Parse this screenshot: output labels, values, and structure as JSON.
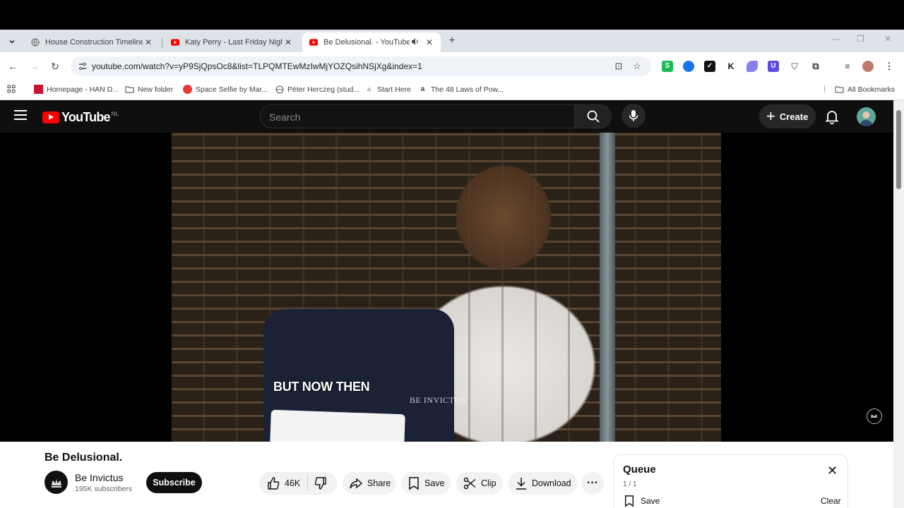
{
  "browser": {
    "tabs": [
      {
        "title": "House Construction Timeline",
        "active": false
      },
      {
        "title": "Katy Perry - Last Friday Night (T",
        "active": false
      },
      {
        "title": "Be Delusional. - YouTube",
        "active": true
      }
    ],
    "url": "youtube.com/watch?v=yP9SjQpsOc8&list=TLPQMTEwMzIwMjYOZQsihNSjXg&index=1",
    "bookmarks": [
      {
        "label": "Homepage - HAN D..."
      },
      {
        "label": "New folder"
      },
      {
        "label": "Space Selfie by Mar..."
      },
      {
        "label": "Péter Herczeg (stud..."
      },
      {
        "label": "Start Here"
      },
      {
        "label": "The 48 Laws of Pow..."
      }
    ],
    "all_bookmarks": "All Bookmarks",
    "extensions": [
      {
        "label": "S",
        "color": "#1db954"
      },
      {
        "label": "",
        "color": "#1a73e8"
      },
      {
        "label": "✓",
        "color": "#111111"
      },
      {
        "label": "K",
        "color": "#ffffff"
      },
      {
        "label": "",
        "color": "#8a7ff0"
      },
      {
        "label": "U",
        "color": "#5b4bdb"
      }
    ]
  },
  "youtube": {
    "logo": "YouTube",
    "country": "NL",
    "search_placeholder": "Search",
    "create_label": "Create",
    "video": {
      "subtitle": "BUT NOW THEN",
      "watermark": "BE INVICTUS",
      "title": "Be Delusional."
    },
    "channel": {
      "name": "Be Invictus",
      "subscribers": "195K subscribers",
      "subscribe_label": "Subscribe"
    },
    "actions": {
      "likes": "46K",
      "share": "Share",
      "save": "Save",
      "clip": "Clip",
      "download": "Download"
    },
    "queue": {
      "title": "Queue",
      "count": "1 / 1",
      "save": "Save",
      "clear": "Clear"
    }
  },
  "colors": {
    "brand_red": "#ff0000",
    "dark_bg": "#0f0f0f"
  }
}
